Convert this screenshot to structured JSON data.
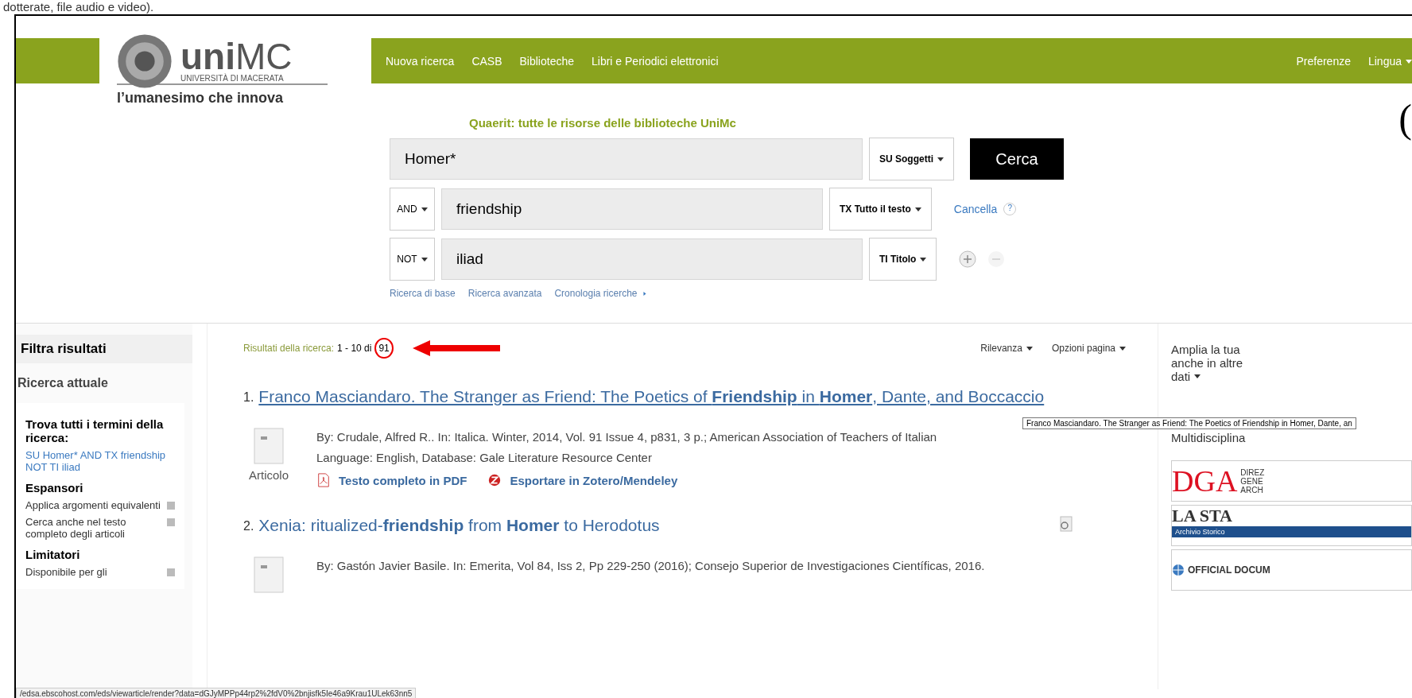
{
  "slide_caption": "dotterate, file audio e video).",
  "header": {
    "logo": {
      "mark_bold": "uni",
      "mark_light": "MC",
      "subtitle": "UNIVERSITÀ DI MACERATA",
      "tagline": "l’umanesimo che innova"
    },
    "nav": [
      "Nuova ricerca",
      "CASB",
      "Biblioteche",
      "Libri e Periodici elettronici"
    ],
    "right_links": [
      {
        "label": "Preferenze",
        "dropdown": false
      },
      {
        "label": "Lingua",
        "dropdown": true
      }
    ],
    "partial_logo": "("
  },
  "search": {
    "title": "Quaerit: tutte le risorse delle biblioteche UniMc",
    "rows": [
      {
        "operator": "",
        "value": "Homer*",
        "field": "SU Soggetti"
      },
      {
        "operator": "AND",
        "value": "friendship",
        "field": "TX Tutto il testo"
      },
      {
        "operator": "NOT",
        "value": "iliad",
        "field": "TI Titolo"
      }
    ],
    "button": "Cerca",
    "clear": "Cancella",
    "help": "?",
    "links": [
      "Ricerca di base",
      "Ricerca avanzata",
      "Cronologia ricerche"
    ]
  },
  "sidebar": {
    "title": "Filtra risultati",
    "section": "Ricerca attuale",
    "groups": [
      {
        "heading": "Trova tutti i termini della ricerca:",
        "query": "SU Homer* AND TX friendship NOT TI iliad"
      },
      {
        "heading": "Espansori",
        "items": [
          "Applica argomenti equivalenti",
          "Cerca anche nel testo completo degli articoli"
        ]
      },
      {
        "heading": "Limitatori",
        "items": [
          "Disponibile per gli"
        ]
      }
    ]
  },
  "results": {
    "label": "Risultati della ricerca:",
    "range": "1 - 10 di",
    "count": "91",
    "sort": [
      "Rilevanza",
      "Opzioni pagina"
    ],
    "items": [
      {
        "number": "1.",
        "title": "Franco Masciandaro. The Stranger as Friend: The Poetics of **Friendship** in **Homer**, Dante, and Boccaccio",
        "underlined": true,
        "meta": [
          "By: Crudale, Alfred R.. In: Italica. Winter, 2014, Vol. 91 Issue 4, p831, 3 p.; American Association of Teachers of Italian",
          "Language: English, Database: Gale Literature Resource Center"
        ],
        "type": "Articolo",
        "links": [
          {
            "kind": "pdf",
            "label": "Testo completo in PDF"
          },
          {
            "kind": "zotero",
            "label": "Esportare in Zotero/Mendeley"
          }
        ]
      },
      {
        "number": "2.",
        "title": "Xenia: ritualized-**friendship** from **Homer** to Herodotus",
        "underlined": false,
        "preview": true,
        "meta": [
          "By: Gastón Javier Basile. In: Emerita, Vol 84, Iss 2, Pp 229-250 (2016); Consejo Superior de Investigaciones Científicas, 2016."
        ]
      }
    ],
    "tooltip": "Franco Masciandaro. The Stranger as Friend: The Poetics of Friendship in Homer, Dante, an"
  },
  "right_panel": {
    "lines": [
      "Amplia la tua",
      "anche in altre",
      "dati"
    ],
    "heading": "Multidisciplina",
    "logos": [
      {
        "kind": "dga",
        "text": "DGA",
        "sub": [
          "DIREZ",
          "GENE",
          "ARCH"
        ]
      },
      {
        "kind": "stampa",
        "text": "LA STA",
        "sub": [
          "Archivio Storico"
        ]
      },
      {
        "kind": "un",
        "text": "OFFICIAL DOCUM"
      }
    ]
  },
  "status_url": "/edsa.ebscohost.com/eds/viewarticle/render?data=dGJyMPPp44rp2%2fdV0%2bnjisfk5Ie46a9Krau1ULek63nn5"
}
